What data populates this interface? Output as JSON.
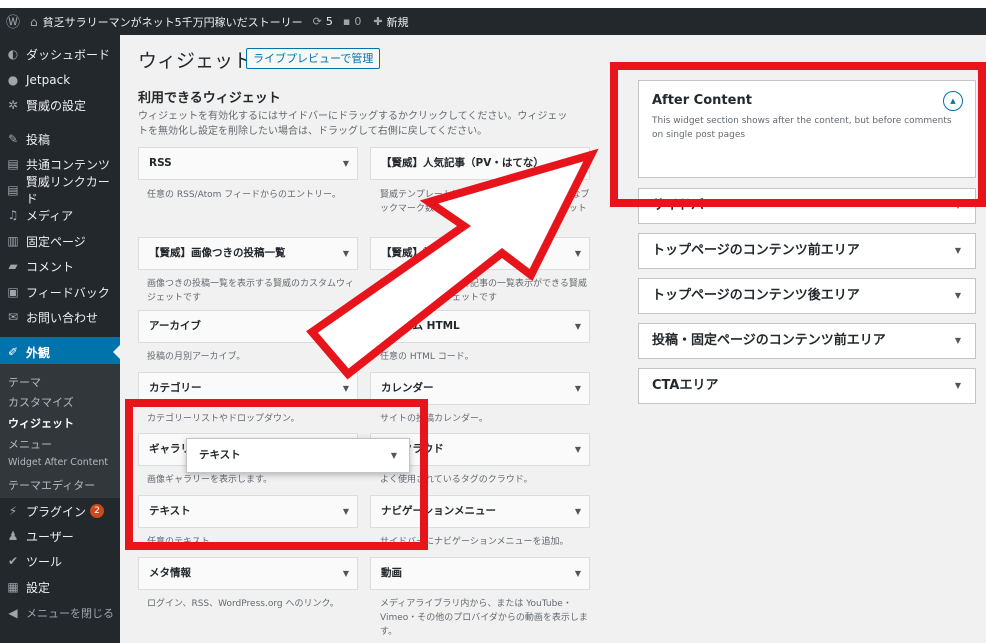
{
  "adminbar": {
    "site_title": "貧乏サラリーマンがネット5千万円稼いだストーリー",
    "updates_count": "5",
    "comments_count": "0",
    "new_label": "新規"
  },
  "sidebar": {
    "items": [
      {
        "label": "ダッシュボード",
        "icon": "dashboard-icon"
      },
      {
        "label": "Jetpack",
        "icon": "jetpack-icon"
      },
      {
        "label": "賢威の設定",
        "icon": "gear-icon"
      },
      {
        "label": "投稿",
        "icon": "pin-icon"
      },
      {
        "label": "共通コンテンツ",
        "icon": "page-icon"
      },
      {
        "label": "賢威リンクカード",
        "icon": "page-icon"
      },
      {
        "label": "メディア",
        "icon": "media-icon"
      },
      {
        "label": "固定ページ",
        "icon": "page-icon"
      },
      {
        "label": "コメント",
        "icon": "comment-icon"
      },
      {
        "label": "フィードバック",
        "icon": "feedback-icon"
      },
      {
        "label": "お問い合わせ",
        "icon": "mail-icon"
      },
      {
        "label": "外観",
        "icon": "brush-icon"
      },
      {
        "label": "プラグイン",
        "icon": "plugin-icon",
        "badge": "2"
      },
      {
        "label": "ユーザー",
        "icon": "user-icon"
      },
      {
        "label": "ツール",
        "icon": "wrench-icon"
      },
      {
        "label": "設定",
        "icon": "settings-icon"
      },
      {
        "label": "メニューを閉じる",
        "icon": "collapse-icon"
      }
    ],
    "submenu": [
      "テーマ",
      "カスタマイズ",
      "ウィジェット",
      "メニュー",
      "Widget After Content",
      "テーマエディター"
    ]
  },
  "main": {
    "title": "ウィジェット",
    "live_preview": "ライブプレビューで管理",
    "available_heading": "利用できるウィジェット",
    "available_desc": "ウィジェットを有効化するにはサイドバーにドラッグするかクリックしてください。ウィジェットを無効化し設定を削除したい場合は、ドラッグして右側に戻してください。"
  },
  "widgets": [
    {
      "title": "RSS",
      "desc": "任意の RSS/Atom フィードからのエントリー。"
    },
    {
      "title": "【賢威】人気記事（PV・はてな）",
      "desc": "賢威テンプレートに付属の人気記事PV数・はてなブックマーク数でランキングを表示するウィジェット"
    },
    {
      "title": "【賢威】画像つきの投稿一覧",
      "desc": "画像つきの投稿一覧を表示する賢威のカスタムウィジェットです"
    },
    {
      "title": "【賢威】記事の一覧表示",
      "desc": "更新日順・投稿日順で記事の一覧表示ができる賢威のカスタムウィジェットです"
    },
    {
      "title": "アーカイブ",
      "desc": "投稿の月別アーカイブ。"
    },
    {
      "title": "カスタム HTML",
      "desc": "任意の HTML コード。"
    },
    {
      "title": "カテゴリー",
      "desc": "カテゴリーリストやドロップダウン。"
    },
    {
      "title": "カレンダー",
      "desc": "サイトの投稿カレンダー。"
    },
    {
      "title": "ギャラリー",
      "desc": "画像ギャラリーを表示します。"
    },
    {
      "title": "タグクラウド",
      "desc": "よく使用されているタグのクラウド。"
    },
    {
      "title": "テキスト",
      "desc": "任意のテキスト。"
    },
    {
      "title": "ナビゲーションメニュー",
      "desc": "サイドバーにナビゲーションメニューを追加。"
    },
    {
      "title": "メタ情報",
      "desc": "ログイン、RSS、WordPress.org へのリンク。"
    },
    {
      "title": "動画",
      "desc": "メディアライブラリ内から、または YouTube・Vimeo・その他のプロバイダからの動画を表示します。"
    }
  ],
  "dragging_widget": {
    "title": "テキスト"
  },
  "widget_areas": {
    "after_content": {
      "title": "After Content",
      "desc": "This widget section shows after the content, but before comments on single post pages"
    },
    "others": [
      "サイドバー",
      "トップページのコンテンツ前エリア",
      "トップページのコンテンツ後エリア",
      "投稿・固定ページのコンテンツ前エリア",
      "CTAエリア"
    ]
  },
  "colors": {
    "highlight": "#e8141c",
    "admin_blue": "#0073aa",
    "admin_dark": "#23282d"
  }
}
